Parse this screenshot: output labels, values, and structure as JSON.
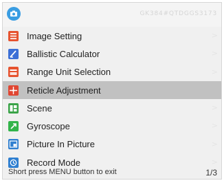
{
  "header": {
    "device_id": "GK384#QTDGGS3173",
    "camera_icon": "camera-icon",
    "accent_color": "#3a9de2"
  },
  "menu": {
    "items": [
      {
        "label": "Image Setting",
        "icon": "image-setting-icon",
        "color": "#e6532f"
      },
      {
        "label": "Ballistic Calculator",
        "icon": "ballistic-calculator-icon",
        "color": "#3b6fd6"
      },
      {
        "label": "Range Unit Selection",
        "icon": "range-unit-icon",
        "color": "#e6532f"
      },
      {
        "label": "Reticle Adjustment",
        "icon": "reticle-icon",
        "color": "#e04632",
        "selected": true
      },
      {
        "label": "Scene",
        "icon": "scene-icon",
        "color": "#3aa348"
      },
      {
        "label": "Gyroscope",
        "icon": "gyroscope-icon",
        "color": "#32b44a"
      },
      {
        "label": "Picture In Picture",
        "icon": "picture-in-picture-icon",
        "color": "#2f7fd0"
      },
      {
        "label": "Record Mode",
        "icon": "record-mode-icon",
        "color": "#2f7fd0"
      }
    ],
    "chevron": ">"
  },
  "footer": {
    "hint": "Short press MENU button to exit",
    "page": "1/3"
  }
}
